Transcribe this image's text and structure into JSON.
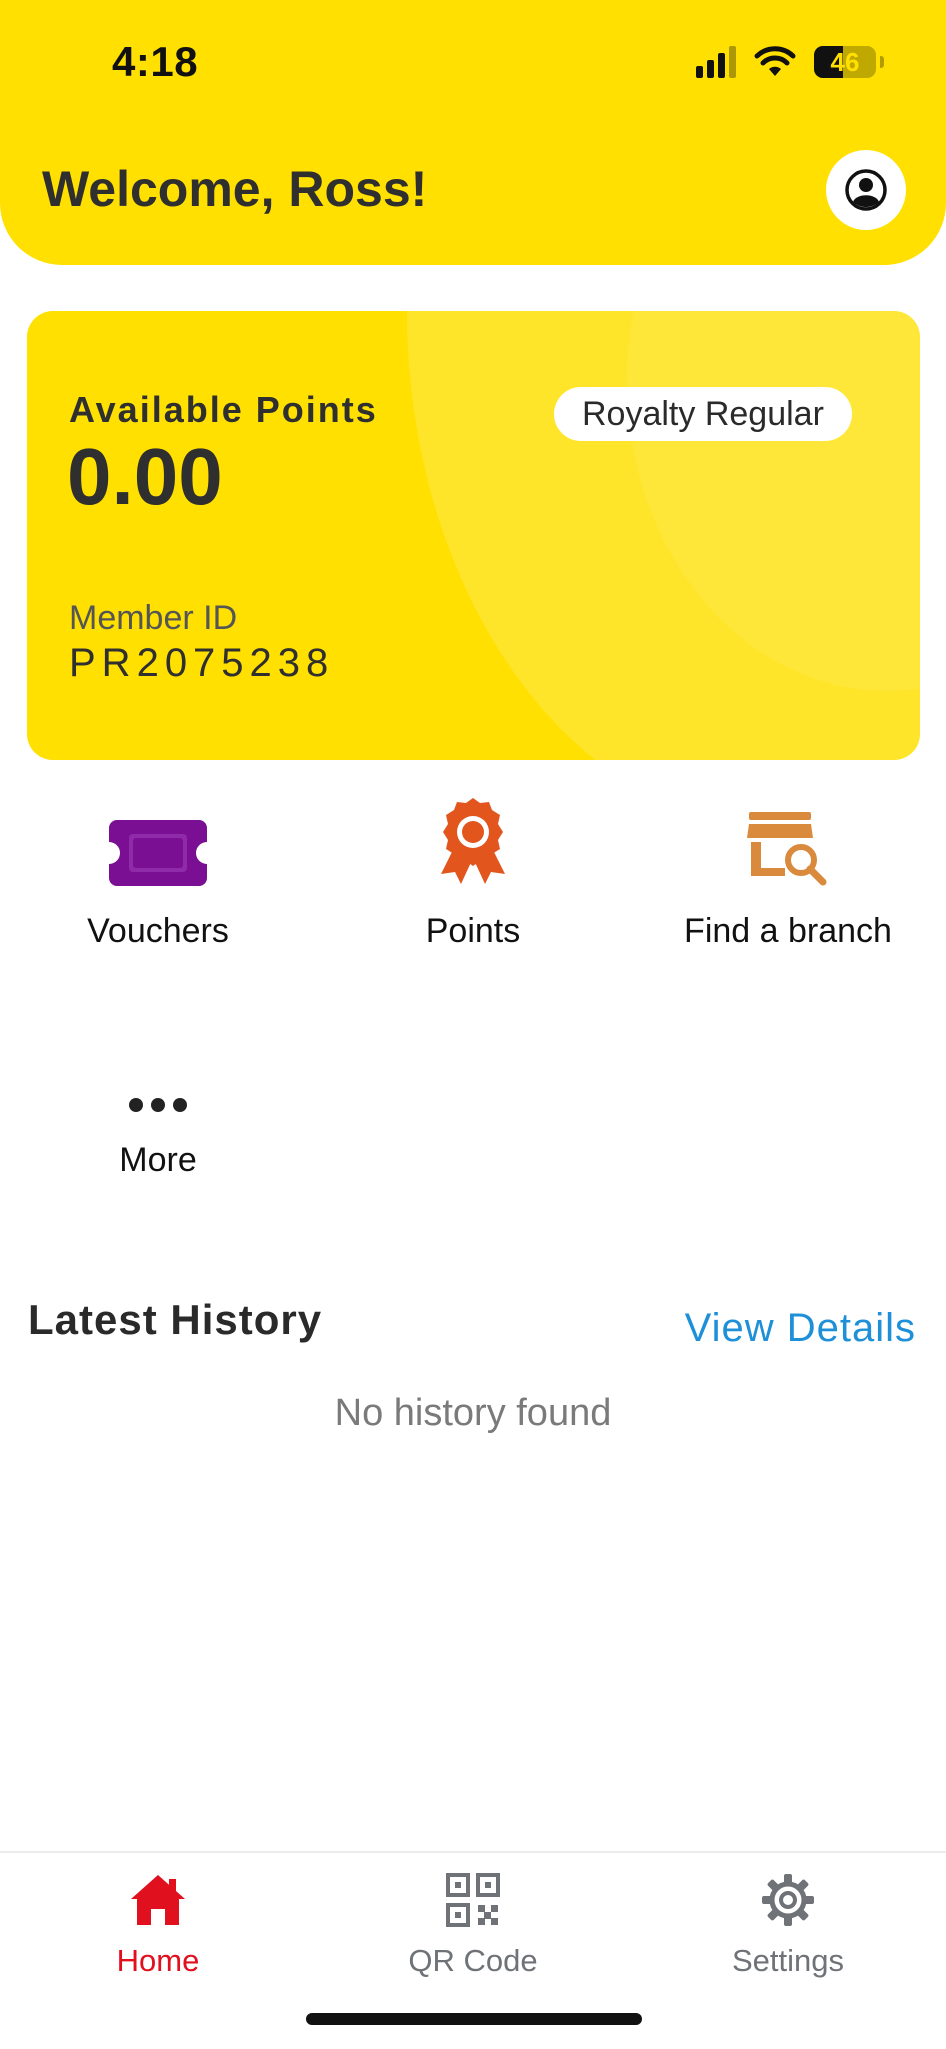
{
  "status_bar": {
    "time": "4:18",
    "battery": "46",
    "battery_level": 0.46
  },
  "header": {
    "welcome": "Welcome, Ross!",
    "profile_icon": "user-circle-icon"
  },
  "card": {
    "points_label": "Available Points",
    "points_value": "0.00",
    "tier": "Royalty Regular",
    "member_label": "Member ID",
    "member_id": "PR2075238"
  },
  "quick_actions": [
    {
      "label": "Vouchers",
      "icon": "ticket-icon",
      "color": "#7B0F93"
    },
    {
      "label": "Points",
      "icon": "award-ribbon-icon",
      "color": "#E2561E"
    },
    {
      "label": "Find a branch",
      "icon": "store-search-icon",
      "color": "#D98A3C"
    },
    {
      "label": "More",
      "icon": "more-dots-icon",
      "color": "#222222"
    }
  ],
  "history": {
    "title": "Latest History",
    "view_details": "View Details",
    "empty": "No history found"
  },
  "tabs": [
    {
      "label": "Home",
      "icon": "home-icon",
      "active": true
    },
    {
      "label": "QR Code",
      "icon": "qr-code-icon",
      "active": false
    },
    {
      "label": "Settings",
      "icon": "gear-icon",
      "active": false
    }
  ],
  "colors": {
    "brand_yellow": "#FFE000",
    "active_tab": "#E0101E",
    "inactive_tab": "#6F7277",
    "link": "#1E90D8"
  }
}
